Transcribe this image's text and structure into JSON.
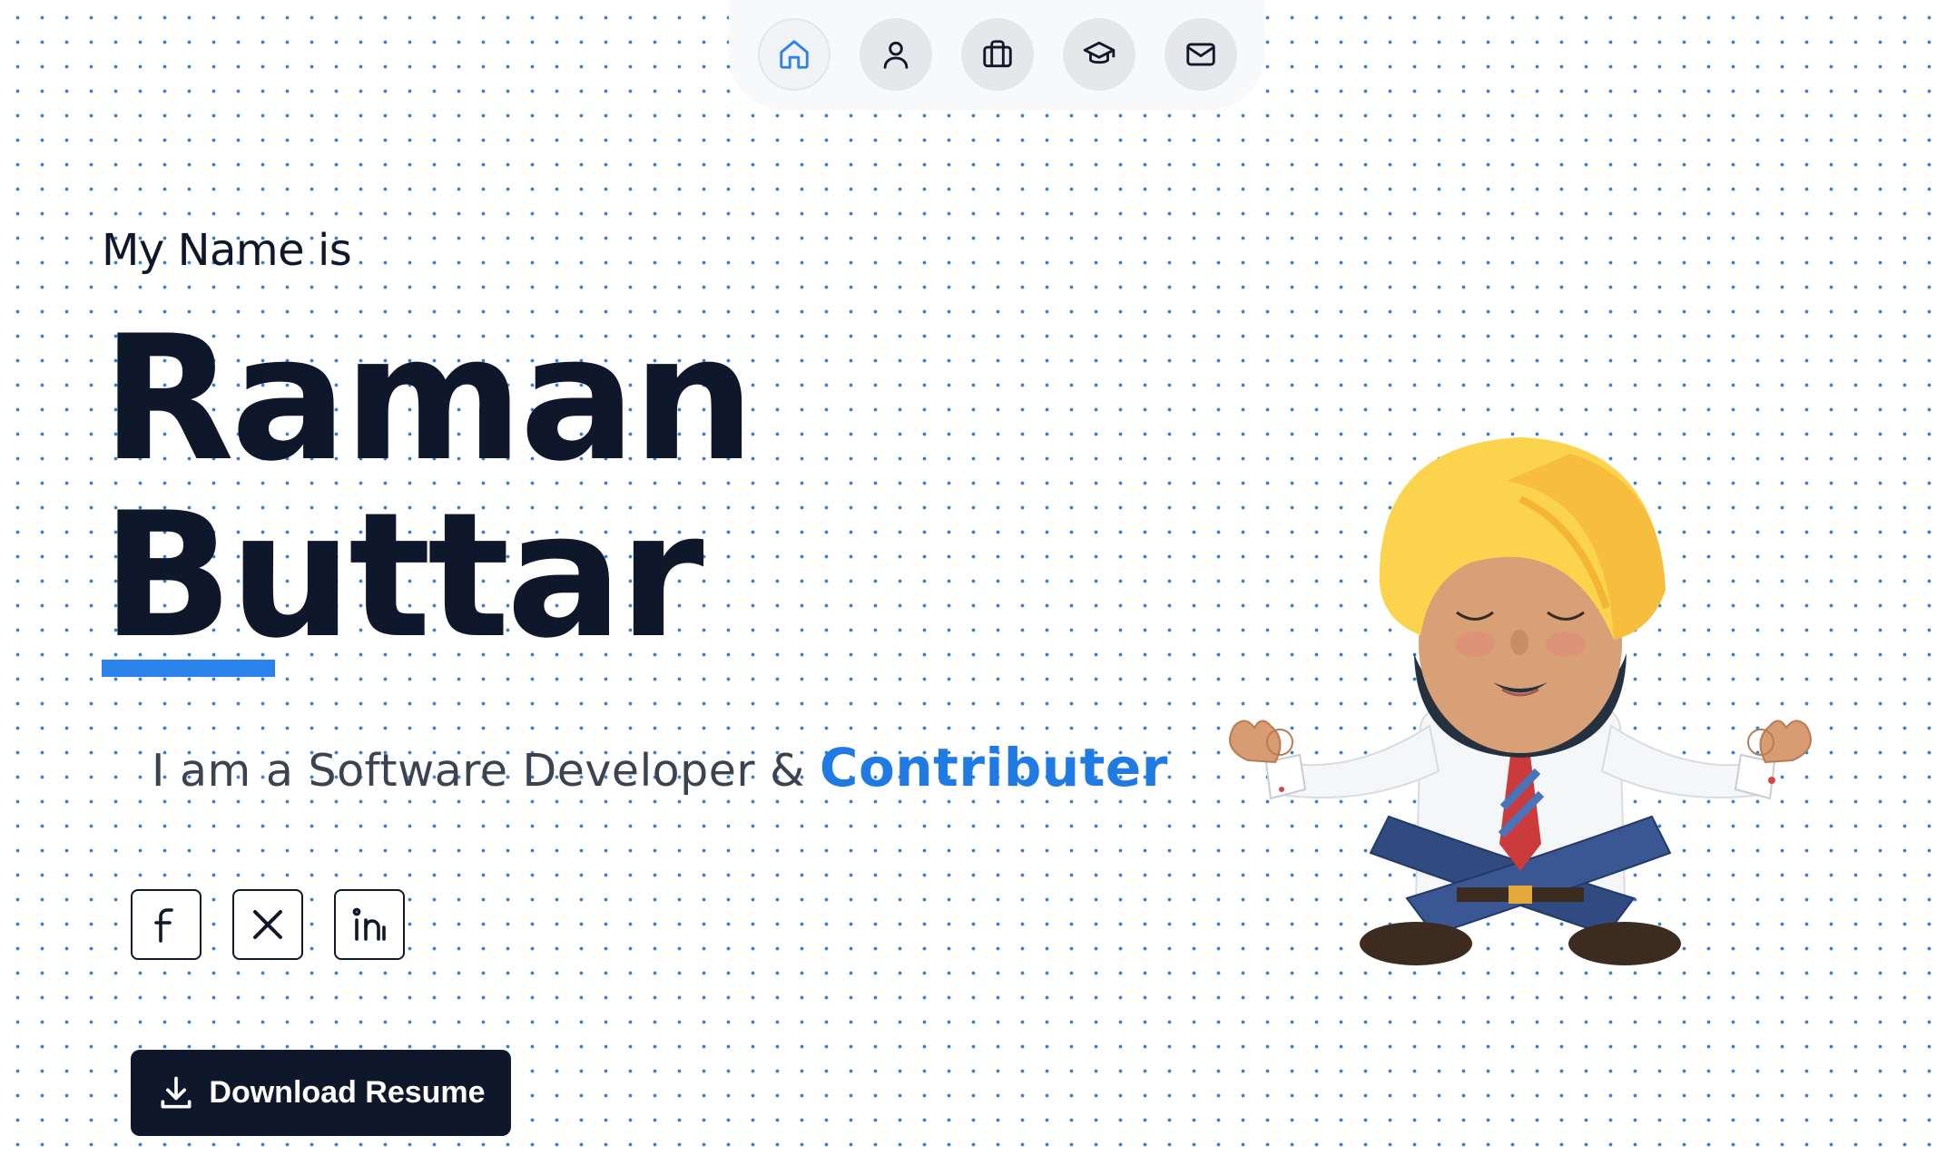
{
  "nav": {
    "items": [
      {
        "icon": "home-icon",
        "active": true
      },
      {
        "icon": "user-icon",
        "active": false
      },
      {
        "icon": "briefcase-icon",
        "active": false
      },
      {
        "icon": "graduation-cap-icon",
        "active": false
      },
      {
        "icon": "mail-icon",
        "active": false
      }
    ]
  },
  "hero": {
    "intro": "My Name is",
    "first_name": "Raman",
    "last_name": "Buttar",
    "tagline_prefix": "I am a Software Developer & ",
    "tagline_highlight": "Contributer"
  },
  "social": [
    {
      "icon": "facebook-icon"
    },
    {
      "icon": "x-icon"
    },
    {
      "icon": "linkedin-icon"
    }
  ],
  "cta": {
    "download_label": "Download Resume",
    "icon": "download-icon"
  },
  "colors": {
    "accent": "#2a83ea",
    "dark": "#0f172a",
    "dot": "#2f7fd6"
  }
}
